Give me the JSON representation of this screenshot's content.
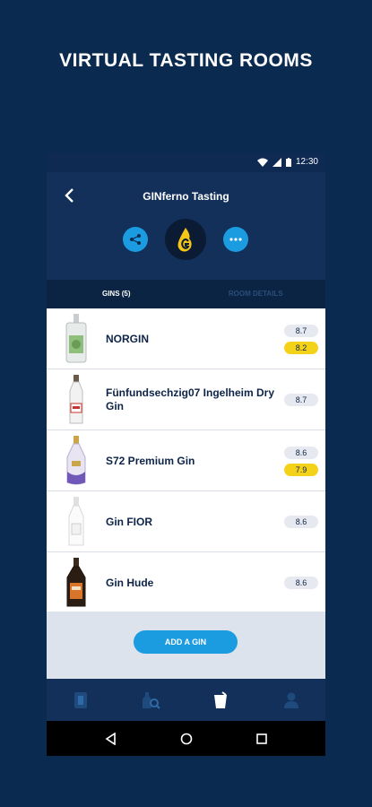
{
  "headline": "VIRTUAL TASTING ROOMS",
  "statusbar": {
    "time": "12:30"
  },
  "header": {
    "title": "GINferno Tasting"
  },
  "tabs": [
    {
      "label": "GINS (5)",
      "active": true
    },
    {
      "label": "ROOM DETAILS",
      "active": false
    }
  ],
  "gins": [
    {
      "name": "NORGIN",
      "ratings": [
        "8.7",
        "8.2"
      ]
    },
    {
      "name": "Fünfundsechzig07 Ingelheim Dry Gin",
      "ratings": [
        "8.7"
      ]
    },
    {
      "name": "S72 Premium Gin",
      "ratings": [
        "8.6",
        "7.9"
      ]
    },
    {
      "name": "Gin FIOR",
      "ratings": [
        "8.6"
      ]
    },
    {
      "name": "Gin Hude",
      "ratings": [
        "8.6"
      ]
    }
  ],
  "add_button": "ADD A GIN",
  "colors": {
    "accent": "#1b9be0",
    "highlight": "#f5d21a",
    "background": "#0b2a50"
  },
  "icons": {
    "share": "share-icon",
    "logo": "gin-logo-icon",
    "more": "more-icon",
    "nav": [
      "gin-card-icon",
      "search-bottle-icon",
      "tasting-glass-icon",
      "profile-icon"
    ]
  }
}
